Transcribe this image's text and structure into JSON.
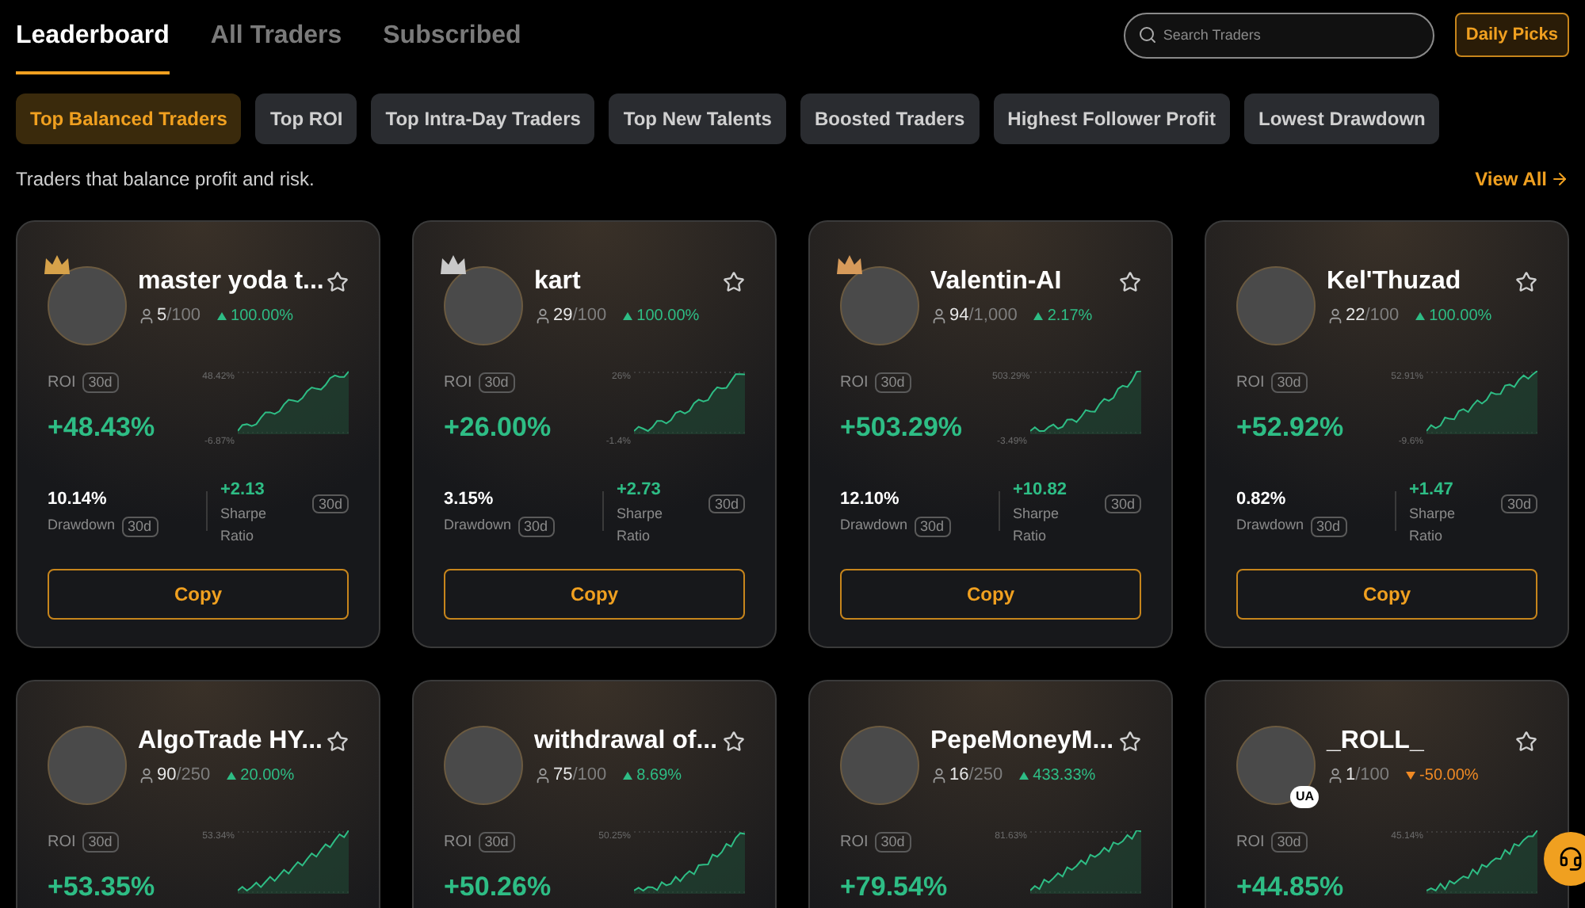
{
  "tabs": [
    {
      "label": "Leaderboard",
      "selected": true
    },
    {
      "label": "All Traders",
      "selected": false
    },
    {
      "label": "Subscribed",
      "selected": false
    }
  ],
  "search": {
    "placeholder": "Search Traders"
  },
  "daily_picks": "Daily Picks",
  "categories": [
    {
      "label": "Top Balanced Traders",
      "selected": true
    },
    {
      "label": "Top ROI",
      "selected": false
    },
    {
      "label": "Top Intra-Day Traders",
      "selected": false
    },
    {
      "label": "Top New Talents",
      "selected": false
    },
    {
      "label": "Boosted Traders",
      "selected": false
    },
    {
      "label": "Highest Follower Profit",
      "selected": false
    },
    {
      "label": "Lowest Drawdown",
      "selected": false
    }
  ],
  "description": "Traders that balance profit and risk.",
  "view_all": "View All",
  "traders": [
    {
      "name": "master yoda t...",
      "crown": {
        "color": "#d6a24a"
      },
      "followers": "5",
      "capacity": "/100",
      "rising": true,
      "change": "100.00%",
      "roi_label": "ROI",
      "roi_period": "30d",
      "roi": "+48.43%",
      "chart_max": "48.42%",
      "chart_min": "-6.87%",
      "drawdown": "10.14%",
      "drawdown_label": "Drawdown",
      "drawdown_period": "30d",
      "sharpe": "+2.13",
      "sharpe_label": "Sharpe Ratio",
      "sharpe_period": "30d",
      "copy": "Copy"
    },
    {
      "name": "kart",
      "crown": {
        "color": "#c9c9c9"
      },
      "followers": "29",
      "capacity": "/100",
      "rising": true,
      "change": "100.00%",
      "roi_label": "ROI",
      "roi_period": "30d",
      "roi": "+26.00%",
      "chart_max": "26%",
      "chart_min": "-1.4%",
      "drawdown": "3.15%",
      "drawdown_label": "Drawdown",
      "drawdown_period": "30d",
      "sharpe": "+2.73",
      "sharpe_label": "Sharpe Ratio",
      "sharpe_period": "30d",
      "copy": "Copy"
    },
    {
      "name": "Valentin-AI",
      "crown": {
        "color": "#d69a5a"
      },
      "followers": "94",
      "capacity": "/1,000",
      "rising": true,
      "change": "2.17%",
      "roi_label": "ROI",
      "roi_period": "30d",
      "roi": "+503.29%",
      "chart_max": "503.29%",
      "chart_min": "-3.49%",
      "drawdown": "12.10%",
      "drawdown_label": "Drawdown",
      "drawdown_period": "30d",
      "sharpe": "+10.82",
      "sharpe_label": "Sharpe Ratio",
      "sharpe_period": "30d",
      "copy": "Copy"
    },
    {
      "name": "Kel'Thuzad",
      "followers": "22",
      "capacity": "/100",
      "rising": true,
      "change": "100.00%",
      "roi_label": "ROI",
      "roi_period": "30d",
      "roi": "+52.92%",
      "chart_max": "52.91%",
      "chart_min": "-9.6%",
      "drawdown": "0.82%",
      "drawdown_label": "Drawdown",
      "drawdown_period": "30d",
      "sharpe": "+1.47",
      "sharpe_label": "Sharpe Ratio",
      "sharpe_period": "30d",
      "copy": "Copy"
    },
    {
      "name": "AlgoTrade HY...",
      "followers": "90",
      "capacity": "/250",
      "rising": true,
      "change": "20.00%",
      "roi_label": "ROI",
      "roi_period": "30d",
      "roi": "+53.35%",
      "chart_max": "53.34%"
    },
    {
      "name": "withdrawal of...",
      "followers": "75",
      "capacity": "/100",
      "rising": true,
      "change": "8.69%",
      "roi_label": "ROI",
      "roi_period": "30d",
      "roi": "+50.26%",
      "chart_max": "50.25%"
    },
    {
      "name": "PepeMoneyM...",
      "followers": "16",
      "capacity": "/250",
      "rising": true,
      "change": "433.33%",
      "roi_label": "ROI",
      "roi_period": "30d",
      "roi": "+79.54%",
      "chart_max": "81.63%"
    },
    {
      "name": "_ROLL_",
      "badge": "UA",
      "followers": "1",
      "capacity": "/100",
      "rising": false,
      "change": "-50.00%",
      "roi_label": "ROI",
      "roi_period": "30d",
      "roi": "+44.85%",
      "chart_max": "45.14%"
    }
  ]
}
